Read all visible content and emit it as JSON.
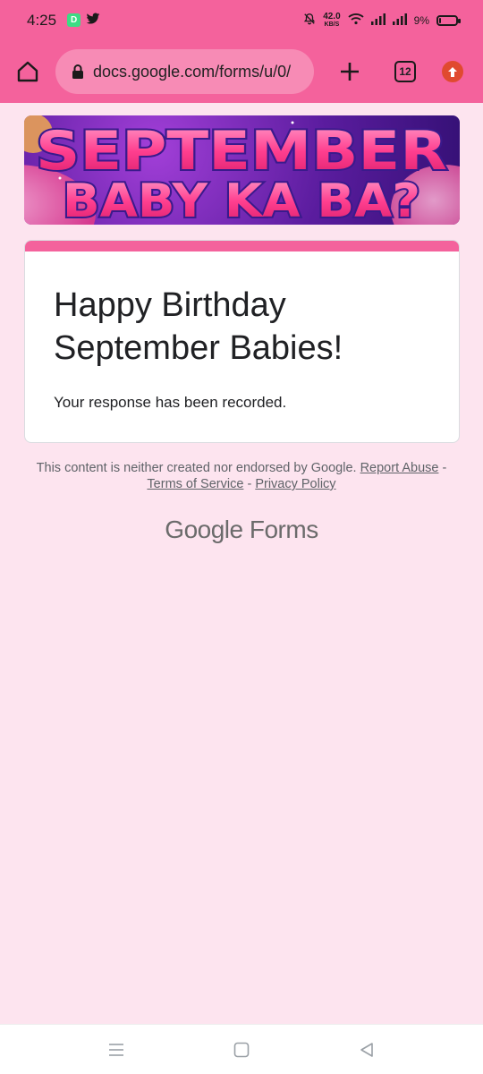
{
  "status_bar": {
    "time": "4:25",
    "app_icon": "D",
    "net_speed_value": "42.0",
    "net_speed_unit": "KB/S",
    "battery_percent": "9%",
    "battery_level": 0.09
  },
  "browser": {
    "url": "docs.google.com/forms/u/0/",
    "tab_count": "12"
  },
  "banner": {
    "line1": "SEPTEMBER",
    "line2": "BABY KA BA?"
  },
  "form": {
    "title": "Happy Birthday September Babies!",
    "message": "Your response has been recorded."
  },
  "footer": {
    "disclaimer": "This content is neither created nor endorsed by Google.",
    "report_abuse": "Report Abuse",
    "separator": "-",
    "terms": "Terms of Service",
    "privacy": "Privacy Policy",
    "brand_google": "Google",
    "brand_forms": "Forms"
  },
  "colors": {
    "accent": "#f4629c",
    "background": "#fde4ef"
  }
}
